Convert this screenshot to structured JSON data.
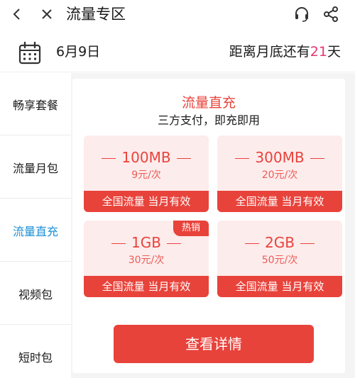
{
  "header": {
    "title": "流量专区",
    "icons": [
      "back-icon",
      "close-icon",
      "customer-service-icon",
      "share-icon"
    ]
  },
  "datebar": {
    "date": "6月9日",
    "remain_prefix": "距离月底还有",
    "remain_days": "21",
    "remain_suffix": "天",
    "accent_color": "#e6356f"
  },
  "sidebar": {
    "items": [
      {
        "label": "畅享套餐",
        "active": false
      },
      {
        "label": "流量月包",
        "active": false
      },
      {
        "label": "流量直充",
        "active": true
      },
      {
        "label": "视频包",
        "active": false
      },
      {
        "label": "短时包",
        "active": false
      }
    ],
    "active_color": "#1a8fd6"
  },
  "main": {
    "title": "流量直充",
    "subtitle": "三方支付，即充即用",
    "cards": [
      {
        "amount": "100MB",
        "price": "9元/次",
        "footer": "全国流量 当月有效",
        "badge": ""
      },
      {
        "amount": "300MB",
        "price": "20元/次",
        "footer": "全国流量 当月有效",
        "badge": ""
      },
      {
        "amount": "1GB",
        "price": "30元/次",
        "footer": "全国流量 当月有效",
        "badge": "热销"
      },
      {
        "amount": "2GB",
        "price": "50元/次",
        "footer": "全国流量 当月有效",
        "badge": ""
      }
    ],
    "button_label": "查看详情",
    "brand_color": "#e8433b"
  }
}
